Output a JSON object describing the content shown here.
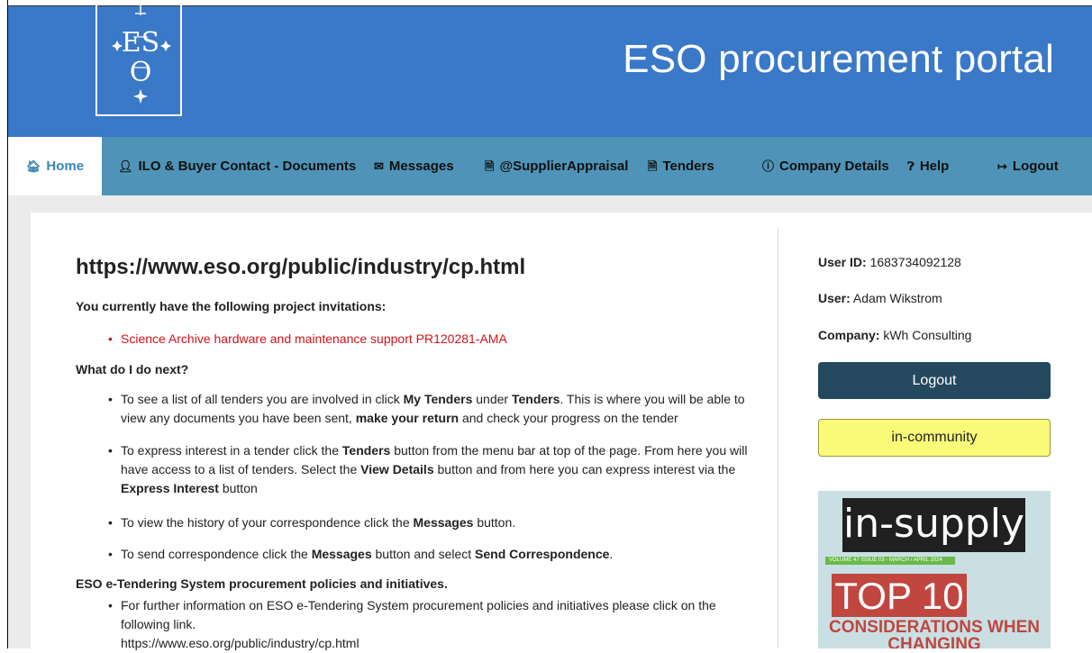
{
  "header": {
    "title": "ESO procurement portal",
    "logo_letters": "ESO"
  },
  "nav": [
    {
      "label": "Home",
      "icon": "home-icon"
    },
    {
      "label": "ILO & Buyer Contact - Documents",
      "icon": "user-icon"
    },
    {
      "label": "Messages",
      "icon": "envelope-icon"
    },
    {
      "label": "@SupplierAppraisal",
      "icon": "document-icon"
    },
    {
      "label": "Tenders",
      "icon": "document-icon"
    },
    {
      "label": "Company Details",
      "icon": "info-icon"
    },
    {
      "label": "Help",
      "icon": "question-icon"
    },
    {
      "label": "Logout",
      "icon": "sign-out-icon"
    }
  ],
  "main": {
    "page_url": "https://www.eso.org/public/industry/cp.html",
    "invitations_heading": "You currently have the following project invitations:",
    "invitations": [
      "Science Archive hardware and maintenance support PR120281-AMA"
    ],
    "next_heading": "What do I do next?",
    "steps": [
      {
        "p1": "To see a list of all tenders you are involved in click ",
        "b1": "My Tenders",
        "p2": " under ",
        "b2": "Tenders",
        "p3": ". This is where you will be able to view any documents you have been sent, ",
        "b3": "make your return",
        "p4": " and check your progress on the tender"
      },
      {
        "p1": "To express interest in a tender click the ",
        "b1": "Tenders",
        "p2": " button from the menu bar at top of the page. From here you will have access to a list of tenders. Select the ",
        "b2": "View Details",
        "p3": " button and from here you can express interest via the ",
        "b3": "Express Interest",
        "p4": " button"
      },
      {
        "p1": "To view the history of your correspondence click the ",
        "b1": "Messages",
        "p2": " button."
      },
      {
        "p1": "To send correspondence click the ",
        "b1": "Messages",
        "p2": " button and select ",
        "b2": "Send Correspondence",
        "p3": "."
      }
    ],
    "policies_heading": "ESO e-Tendering System procurement policies and initiatives.",
    "policies_text": "For further information on ESO e-Tendering System procurement policies and initiatives please click on the following link.",
    "policies_link": "https://www.eso.org/public/industry/cp.html"
  },
  "sidebar": {
    "user_id_label": "User ID:",
    "user_id": "1683734092128",
    "user_label": "User:",
    "user": "Adam Wikstrom",
    "company_label": "Company:",
    "company": "kWh Consulting",
    "logout_button": "Logout",
    "community_button": "in-community",
    "magazine": {
      "title": "in-supply",
      "issue": "VOLUME 47 ISSUE 03 - MARCH / APRIL 2024",
      "top": "TOP 10",
      "subtitle": "CONSIDERATIONS WHEN CHANGING"
    }
  },
  "colors": {
    "header": "#3a78c8",
    "nav": "#4f94b8",
    "logout_button": "#24495e",
    "community_button": "#fbfb7a",
    "invitation_link": "#d0121b"
  }
}
